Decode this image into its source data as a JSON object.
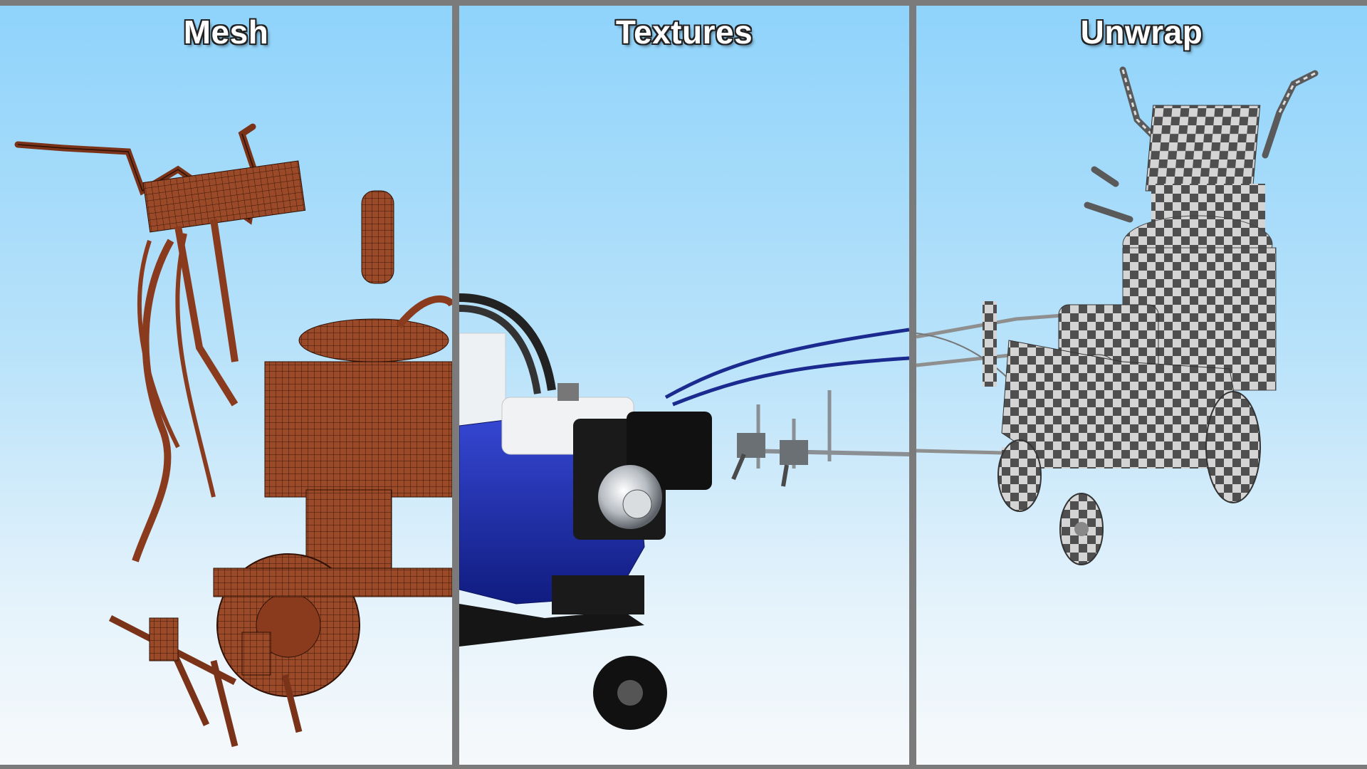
{
  "panels": [
    {
      "title": "Mesh",
      "style": "wireframe",
      "color": "#8a3b1e"
    },
    {
      "title": "Textures",
      "style": "textured",
      "color": "#1d2fa6"
    },
    {
      "title": "Unwrap",
      "style": "checker",
      "color": "#5e5e5e"
    }
  ],
  "colors": {
    "frame": "#7b7b7b",
    "sky_top": "#8fd3fb",
    "sky_bottom": "#f6f9fb"
  }
}
